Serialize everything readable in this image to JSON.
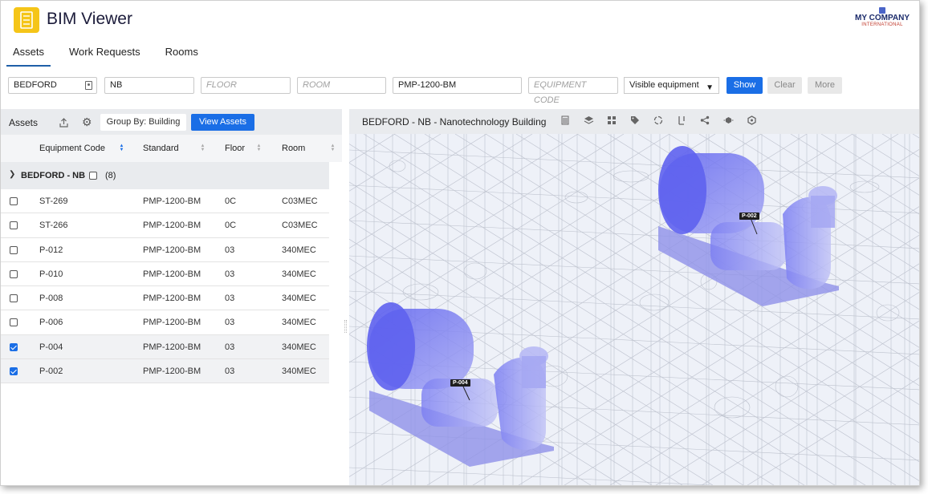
{
  "app": {
    "title": "BIM Viewer",
    "brand_name": "MY COMPANY",
    "brand_sub": "INTERNATIONAL"
  },
  "tabs": [
    {
      "label": "Assets",
      "active": true
    },
    {
      "label": "Work Requests",
      "active": false
    },
    {
      "label": "Rooms",
      "active": false
    }
  ],
  "filters": {
    "site_value": "BEDFORD",
    "building_value": "NB",
    "floor_placeholder": "FLOOR",
    "room_placeholder": "ROOM",
    "standard_value": "PMP-1200-BM",
    "equipment_code_placeholder": "EQUIPMENT CODE",
    "equipment_select": "Visible equipment",
    "show_label": "Show",
    "clear_label": "Clear",
    "more_label": "More"
  },
  "assets_panel": {
    "title": "Assets",
    "group_by_label": "Group By: Building",
    "view_assets_label": "View Assets",
    "columns": [
      "Equipment Code",
      "Standard",
      "Floor",
      "Room"
    ],
    "group": {
      "label": "BEDFORD - NB",
      "count": "(8)"
    },
    "rows": [
      {
        "code": "ST-269",
        "standard": "PMP-1200-BM",
        "floor": "0C",
        "room": "C03MEC",
        "checked": false
      },
      {
        "code": "ST-266",
        "standard": "PMP-1200-BM",
        "floor": "0C",
        "room": "C03MEC",
        "checked": false
      },
      {
        "code": "P-012",
        "standard": "PMP-1200-BM",
        "floor": "03",
        "room": "340MEC",
        "checked": false
      },
      {
        "code": "P-010",
        "standard": "PMP-1200-BM",
        "floor": "03",
        "room": "340MEC",
        "checked": false
      },
      {
        "code": "P-008",
        "standard": "PMP-1200-BM",
        "floor": "03",
        "room": "340MEC",
        "checked": false
      },
      {
        "code": "P-006",
        "standard": "PMP-1200-BM",
        "floor": "03",
        "room": "340MEC",
        "checked": false
      },
      {
        "code": "P-004",
        "standard": "PMP-1200-BM",
        "floor": "03",
        "room": "340MEC",
        "checked": true
      },
      {
        "code": "P-002",
        "standard": "PMP-1200-BM",
        "floor": "03",
        "room": "340MEC",
        "checked": true
      }
    ]
  },
  "viewer": {
    "title": "BEDFORD - NB - Nanotechnology Building",
    "tools": [
      "building-icon",
      "layers-icon",
      "grid-icon",
      "tag-icon",
      "rotate-icon",
      "section-icon",
      "share-icon",
      "explode-icon",
      "model-icon"
    ],
    "labels": [
      "P-002",
      "P-004"
    ]
  },
  "colors": {
    "accent": "#1a6ee6",
    "app_icon": "#f5c518",
    "equipment_highlight": "#6f72f0"
  }
}
